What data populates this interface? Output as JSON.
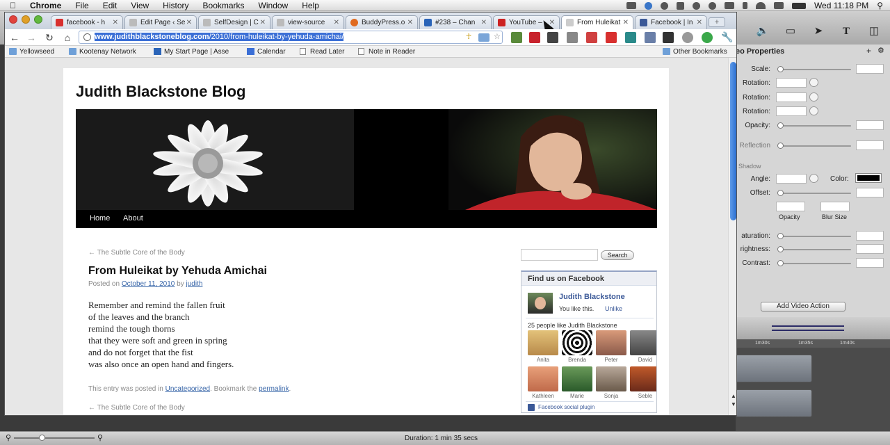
{
  "menubar": {
    "app": "Chrome",
    "items": [
      "File",
      "Edit",
      "View",
      "History",
      "Bookmarks",
      "Window",
      "Help"
    ],
    "clock": "Wed 11:18 PM"
  },
  "tabs": [
    {
      "label": "facebook - h",
      "favcolor": "#d8302f"
    },
    {
      "label": "Edit Page ‹ Se",
      "favcolor": "#9a9a9a"
    },
    {
      "label": "SelfDesign | C",
      "favcolor": "#9a9a9a"
    },
    {
      "label": "view-source",
      "favcolor": "#9a9a9a"
    },
    {
      "label": "BuddyPress.o",
      "favcolor": "#e06a1f"
    },
    {
      "label": "#238 – Chan",
      "favcolor": "#2a64b8"
    },
    {
      "label": "YouTube –",
      "favcolor": "#cc2222"
    },
    {
      "label": "From Huleikat",
      "favcolor": "#9a9a9a"
    },
    {
      "label": "Facebook | In",
      "favcolor": "#3b5998"
    }
  ],
  "omnibox": {
    "host": "www.judithblackstoneblog.com",
    "path": "/2010/from-huleikat-by-yehuda-amichai/"
  },
  "bookmarks": [
    {
      "label": "Yellowseed",
      "icon": "folder"
    },
    {
      "label": "Kootenay Network",
      "icon": "folder"
    },
    {
      "label": "My Start Page | Asse",
      "icon": "A"
    },
    {
      "label": "Calendar",
      "icon": "31"
    },
    {
      "label": "Read Later",
      "icon": "page"
    },
    {
      "label": "Note in Reader",
      "icon": "page"
    }
  ],
  "other_bookmarks": "Other Bookmarks",
  "site": {
    "title": "Judith Blackstone Blog",
    "nav": [
      "Home",
      "About"
    ],
    "prev_link": "← The Subtle Core of the Body",
    "post_title": "From Huleikat by Yehuda Amichai",
    "posted_on": "Posted on",
    "date": "October 11, 2010",
    "by": "by",
    "author": "judith",
    "poem": [
      "Remember and remind the fallen fruit",
      "of the leaves and the branch",
      "remind the tough thorns",
      "that they were soft and green in spring",
      "and do not forget that the fist",
      "was also once an open hand and fingers."
    ],
    "footer_prefix": "This entry was posted in",
    "category": "Uncategorized",
    "footer_mid": ". Bookmark the",
    "permalink": "permalink",
    "footer_end": ".",
    "prev_link_bottom": "← The Subtle Core of the Body"
  },
  "sidebar": {
    "search_button": "Search",
    "fb_header": "Find us on Facebook",
    "page_name": "Judith Blackstone",
    "you_like": "You like this.",
    "unlike": "Unlike",
    "like_count": "25 people like Judith Blackstone",
    "fans": [
      "Anita",
      "Brenda",
      "Peter",
      "David",
      "Kathleen",
      "Marie",
      "Sonja",
      "Seble"
    ],
    "plugin": "Facebook social plugin"
  },
  "editor": {
    "title": "eo Properties",
    "scale": "Scale:",
    "xrot": "Rotation:",
    "yrot": "Rotation:",
    "zrot": "Rotation:",
    "opacity": "Opacity:",
    "reflection": "Reflection",
    "shadow": "Shadow",
    "angle": "Angle:",
    "color": "Color:",
    "offset": "Offset:",
    "sh_opacity": "Opacity",
    "blur": "Blur Size",
    "saturation": "aturation:",
    "brightness": "rightness:",
    "contrast": "Contrast:",
    "add_action": "Add Video Action",
    "t1": "1m30s",
    "t2": "1m35s",
    "t3": "1m40s"
  },
  "status": {
    "duration": "Duration: 1 min 35 secs"
  }
}
